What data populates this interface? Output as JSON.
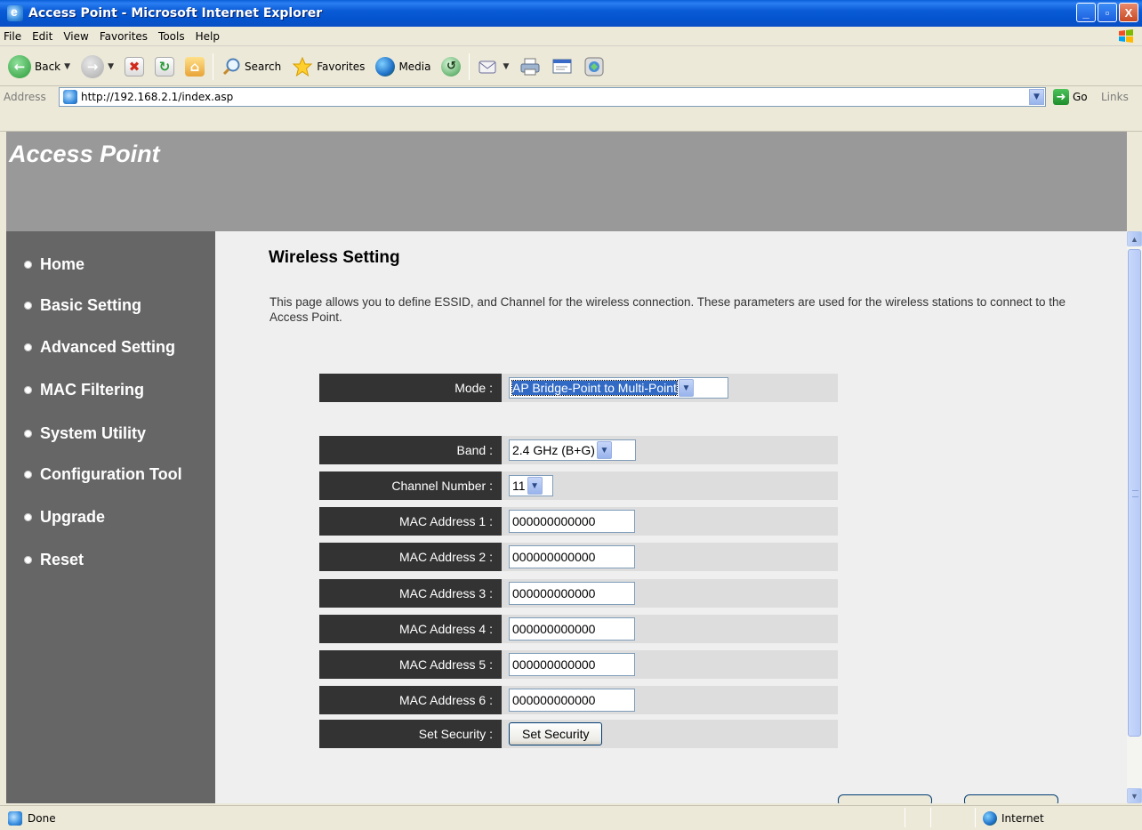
{
  "window": {
    "title": "Access Point - Microsoft Internet Explorer",
    "controls": [
      "_",
      "▫",
      "X"
    ]
  },
  "menu": [
    "File",
    "Edit",
    "View",
    "Favorites",
    "Tools",
    "Help"
  ],
  "toolbar": {
    "back": "Back",
    "search": "Search",
    "favorites": "Favorites",
    "media": "Media"
  },
  "address": {
    "label": "Address",
    "url": "http://192.168.2.1/index.asp",
    "go": "Go",
    "links": "Links"
  },
  "page": {
    "banner_title": "Access Point",
    "nav": [
      "Home",
      "Basic Setting",
      "Advanced Setting",
      "MAC Filtering",
      "System Utility",
      "Configuration Tool",
      "Upgrade",
      "Reset"
    ],
    "heading": "Wireless Setting",
    "description": "This page allows you to define ESSID, and Channel for the wireless connection. These parameters are used for the wireless stations to connect to the Access Point.",
    "mode": {
      "label": "Mode :",
      "value": "AP Bridge-Point to Multi-Point"
    },
    "band": {
      "label": "Band :",
      "value": "2.4 GHz (B+G)"
    },
    "channel": {
      "label": "Channel Number :",
      "value": "11"
    },
    "mac_addresses": [
      {
        "label": "MAC Address 1 :",
        "value": "000000000000"
      },
      {
        "label": "MAC Address 2 :",
        "value": "000000000000"
      },
      {
        "label": "MAC Address 3 :",
        "value": "000000000000"
      },
      {
        "label": "MAC Address 4 :",
        "value": "000000000000"
      },
      {
        "label": "MAC Address 5 :",
        "value": "000000000000"
      },
      {
        "label": "MAC Address 6 :",
        "value": "000000000000"
      }
    ],
    "security": {
      "label": "Set Security :",
      "button": "Set Security"
    }
  },
  "status": {
    "text": "Done",
    "zone": "Internet"
  },
  "colors": {
    "banner": "#999999",
    "sidebar": "#666666",
    "label_bg": "#333333",
    "row_bg": "#dddddd",
    "main_bg": "#efefef"
  }
}
